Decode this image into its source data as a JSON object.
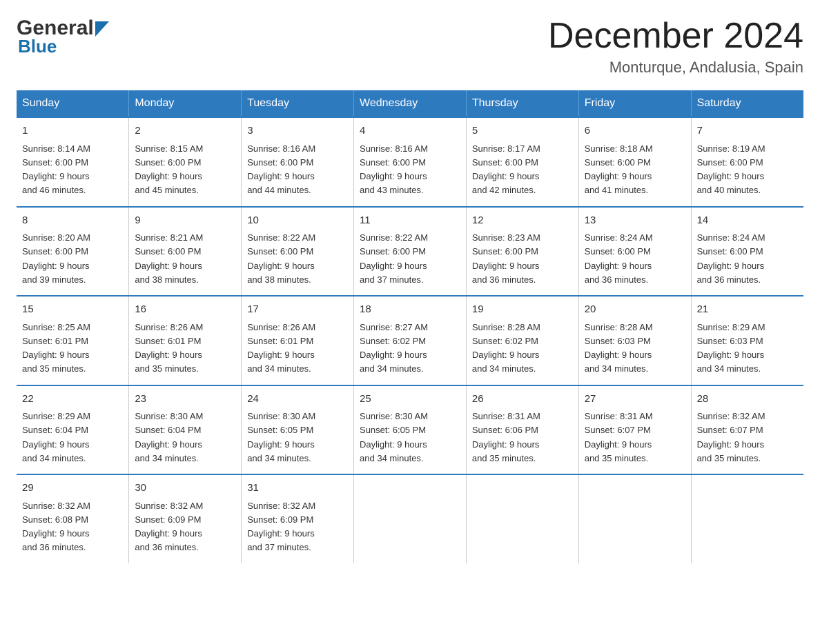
{
  "logo": {
    "general": "General",
    "blue": "Blue",
    "arrow_color": "#1a6fad"
  },
  "header": {
    "title": "December 2024",
    "subtitle": "Monturque, Andalusia, Spain"
  },
  "days_of_week": [
    "Sunday",
    "Monday",
    "Tuesday",
    "Wednesday",
    "Thursday",
    "Friday",
    "Saturday"
  ],
  "weeks": [
    [
      {
        "day": "1",
        "sunrise": "8:14 AM",
        "sunset": "6:00 PM",
        "daylight": "9 hours and 46 minutes."
      },
      {
        "day": "2",
        "sunrise": "8:15 AM",
        "sunset": "6:00 PM",
        "daylight": "9 hours and 45 minutes."
      },
      {
        "day": "3",
        "sunrise": "8:16 AM",
        "sunset": "6:00 PM",
        "daylight": "9 hours and 44 minutes."
      },
      {
        "day": "4",
        "sunrise": "8:16 AM",
        "sunset": "6:00 PM",
        "daylight": "9 hours and 43 minutes."
      },
      {
        "day": "5",
        "sunrise": "8:17 AM",
        "sunset": "6:00 PM",
        "daylight": "9 hours and 42 minutes."
      },
      {
        "day": "6",
        "sunrise": "8:18 AM",
        "sunset": "6:00 PM",
        "daylight": "9 hours and 41 minutes."
      },
      {
        "day": "7",
        "sunrise": "8:19 AM",
        "sunset": "6:00 PM",
        "daylight": "9 hours and 40 minutes."
      }
    ],
    [
      {
        "day": "8",
        "sunrise": "8:20 AM",
        "sunset": "6:00 PM",
        "daylight": "9 hours and 39 minutes."
      },
      {
        "day": "9",
        "sunrise": "8:21 AM",
        "sunset": "6:00 PM",
        "daylight": "9 hours and 38 minutes."
      },
      {
        "day": "10",
        "sunrise": "8:22 AM",
        "sunset": "6:00 PM",
        "daylight": "9 hours and 38 minutes."
      },
      {
        "day": "11",
        "sunrise": "8:22 AM",
        "sunset": "6:00 PM",
        "daylight": "9 hours and 37 minutes."
      },
      {
        "day": "12",
        "sunrise": "8:23 AM",
        "sunset": "6:00 PM",
        "daylight": "9 hours and 36 minutes."
      },
      {
        "day": "13",
        "sunrise": "8:24 AM",
        "sunset": "6:00 PM",
        "daylight": "9 hours and 36 minutes."
      },
      {
        "day": "14",
        "sunrise": "8:24 AM",
        "sunset": "6:00 PM",
        "daylight": "9 hours and 36 minutes."
      }
    ],
    [
      {
        "day": "15",
        "sunrise": "8:25 AM",
        "sunset": "6:01 PM",
        "daylight": "9 hours and 35 minutes."
      },
      {
        "day": "16",
        "sunrise": "8:26 AM",
        "sunset": "6:01 PM",
        "daylight": "9 hours and 35 minutes."
      },
      {
        "day": "17",
        "sunrise": "8:26 AM",
        "sunset": "6:01 PM",
        "daylight": "9 hours and 34 minutes."
      },
      {
        "day": "18",
        "sunrise": "8:27 AM",
        "sunset": "6:02 PM",
        "daylight": "9 hours and 34 minutes."
      },
      {
        "day": "19",
        "sunrise": "8:28 AM",
        "sunset": "6:02 PM",
        "daylight": "9 hours and 34 minutes."
      },
      {
        "day": "20",
        "sunrise": "8:28 AM",
        "sunset": "6:03 PM",
        "daylight": "9 hours and 34 minutes."
      },
      {
        "day": "21",
        "sunrise": "8:29 AM",
        "sunset": "6:03 PM",
        "daylight": "9 hours and 34 minutes."
      }
    ],
    [
      {
        "day": "22",
        "sunrise": "8:29 AM",
        "sunset": "6:04 PM",
        "daylight": "9 hours and 34 minutes."
      },
      {
        "day": "23",
        "sunrise": "8:30 AM",
        "sunset": "6:04 PM",
        "daylight": "9 hours and 34 minutes."
      },
      {
        "day": "24",
        "sunrise": "8:30 AM",
        "sunset": "6:05 PM",
        "daylight": "9 hours and 34 minutes."
      },
      {
        "day": "25",
        "sunrise": "8:30 AM",
        "sunset": "6:05 PM",
        "daylight": "9 hours and 34 minutes."
      },
      {
        "day": "26",
        "sunrise": "8:31 AM",
        "sunset": "6:06 PM",
        "daylight": "9 hours and 35 minutes."
      },
      {
        "day": "27",
        "sunrise": "8:31 AM",
        "sunset": "6:07 PM",
        "daylight": "9 hours and 35 minutes."
      },
      {
        "day": "28",
        "sunrise": "8:32 AM",
        "sunset": "6:07 PM",
        "daylight": "9 hours and 35 minutes."
      }
    ],
    [
      {
        "day": "29",
        "sunrise": "8:32 AM",
        "sunset": "6:08 PM",
        "daylight": "9 hours and 36 minutes."
      },
      {
        "day": "30",
        "sunrise": "8:32 AM",
        "sunset": "6:09 PM",
        "daylight": "9 hours and 36 minutes."
      },
      {
        "day": "31",
        "sunrise": "8:32 AM",
        "sunset": "6:09 PM",
        "daylight": "9 hours and 37 minutes."
      },
      null,
      null,
      null,
      null
    ]
  ],
  "labels": {
    "sunrise": "Sunrise:",
    "sunset": "Sunset:",
    "daylight": "Daylight:"
  }
}
